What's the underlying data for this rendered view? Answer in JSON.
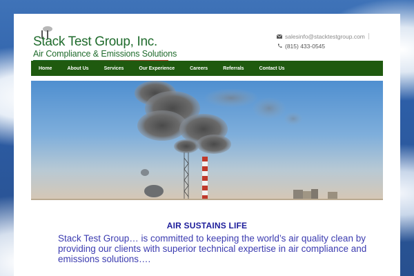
{
  "brand": {
    "name": "Stack Test Group, Inc.",
    "tagline": "Air Compliance & Emissions Solutions"
  },
  "contact": {
    "email": "salesinfo@stacktestgroup.com",
    "phone": "(815) 433-0545",
    "email_icon": "envelope-icon",
    "phone_icon": "phone-icon"
  },
  "nav": {
    "items": [
      {
        "label": "Home"
      },
      {
        "label": "About Us"
      },
      {
        "label": "Services"
      },
      {
        "label": "Our Experience"
      },
      {
        "label": "Careers"
      },
      {
        "label": "Referrals"
      },
      {
        "label": "Contact Us"
      }
    ]
  },
  "hero": {
    "image": "smokestacks-emitting-smoke"
  },
  "content": {
    "headline": "AIR SUSTAINS LIFE",
    "intro": "Stack Test Group… is committed to keeping the world’s air quality clean by providing our clients with superior technical expertise in air compliance and emissions solutions…."
  },
  "colors": {
    "nav_bg": "#1f5a0f",
    "brand_green": "#1f6b2c",
    "headline": "#1c1c9a",
    "body_text": "#3b3bb0"
  }
}
